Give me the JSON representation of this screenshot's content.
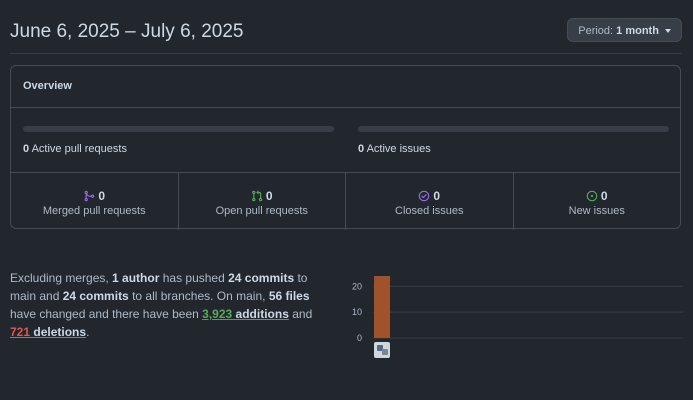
{
  "header": {
    "title": "June 6, 2025 – July 6, 2025",
    "period_label": "Period:",
    "period_value": "1 month"
  },
  "overview": {
    "title": "Overview",
    "active_prs": {
      "count": "0",
      "label": "Active pull requests",
      "fill_fraction": 0
    },
    "active_issues": {
      "count": "0",
      "label": "Active issues",
      "fill_fraction": 0
    },
    "stats": [
      {
        "icon": "git-merge-icon",
        "count": "0",
        "label": "Merged pull requests",
        "color": "#986ee2"
      },
      {
        "icon": "git-pull-request-icon",
        "count": "0",
        "label": "Open pull requests",
        "color": "#57ab5a"
      },
      {
        "icon": "issue-closed-icon",
        "count": "0",
        "label": "Closed issues",
        "color": "#986ee2"
      },
      {
        "icon": "issue-opened-icon",
        "count": "0",
        "label": "New issues",
        "color": "#57ab5a"
      }
    ]
  },
  "summary": {
    "t1": "Excluding merges, ",
    "authors": "1 author",
    "t2": " has pushed ",
    "commits_main": "24 commits",
    "t3": " to main and ",
    "commits_all": "24 commits",
    "t4": " to all branches. On main, ",
    "files": "56 files",
    "t5": " have changed and there have been ",
    "additions_num": "3,923",
    "additions_word": "additions",
    "t6": " and ",
    "deletions_num": "721",
    "deletions_word": "deletions",
    "t7": "."
  },
  "chart_data": {
    "type": "bar",
    "categories": [
      "author"
    ],
    "values": [
      24
    ],
    "yticks": [
      "0",
      "10",
      "20"
    ],
    "ylim": [
      0,
      24
    ],
    "bar_color": "#a0522d",
    "grid": true
  }
}
